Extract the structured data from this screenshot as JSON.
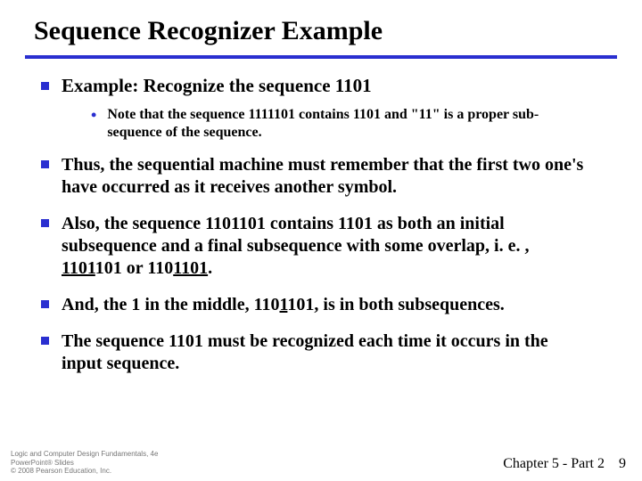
{
  "title": "Sequence Recognizer Example",
  "bullets": {
    "b1": "Example:  Recognize the sequence 1101",
    "sub1": "Note that the sequence 1111101 contains 1101 and \"11\" is a proper sub-sequence of the sequence.",
    "b2": "Thus, the sequential machine must remember that the first two one's have occurred as it receives another symbol.",
    "b3_pre": "Also, the sequence 1101101 contains 1101 as both an initial subsequence and a final subsequence with some overlap, i. e. , ",
    "b3_u1": "1101",
    "b3_mid1": "101 or 110",
    "b3_u2": "1101",
    "b3_post": ".",
    "b4_pre": "And, the 1 in the middle, 110",
    "b4_u": "1",
    "b4_post": "101, is in both subsequences.",
    "b5": "The sequence 1101 must be recognized each time it occurs in the input sequence."
  },
  "footer": {
    "left_l1": "Logic and Computer Design Fundamentals, 4e",
    "left_l2": "PowerPoint® Slides",
    "left_l3": "© 2008 Pearson Education, Inc.",
    "chapter": "Chapter 5 - Part 2",
    "page": "9"
  }
}
